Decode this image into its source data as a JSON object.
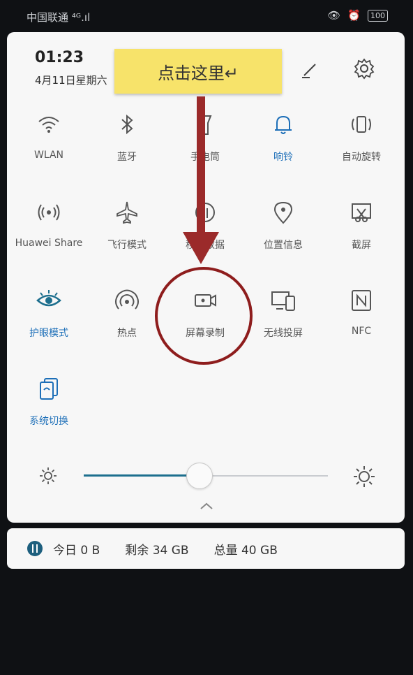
{
  "statusbar": {
    "carrier": "中国联通",
    "signal": "⁴ᴳ.ıl",
    "battery": "100"
  },
  "header": {
    "time": "01:23",
    "date": "4月11日星期六"
  },
  "annotation": {
    "callout_text": "点击这里↵"
  },
  "tiles": [
    {
      "label": "WLAN",
      "icon": "wifi-icon",
      "active": false
    },
    {
      "label": "蓝牙",
      "icon": "bluetooth-icon",
      "active": false
    },
    {
      "label": "手电筒",
      "icon": "flashlight-icon",
      "active": false
    },
    {
      "label": "响铃",
      "icon": "bell-icon",
      "active": true
    },
    {
      "label": "自动旋转",
      "icon": "rotate-icon",
      "active": false
    },
    {
      "label": "Huawei Share",
      "icon": "share-icon",
      "active": false
    },
    {
      "label": "飞行模式",
      "icon": "airplane-icon",
      "active": false
    },
    {
      "label": "移动数据",
      "icon": "mobile-data-icon",
      "active": false
    },
    {
      "label": "位置信息",
      "icon": "location-icon",
      "active": false
    },
    {
      "label": "截屏",
      "icon": "screenshot-icon",
      "active": false
    },
    {
      "label": "护眼模式",
      "icon": "eye-icon",
      "active": true
    },
    {
      "label": "热点",
      "icon": "hotspot-icon",
      "active": false
    },
    {
      "label": "屏幕录制",
      "icon": "screen-record-icon",
      "active": false
    },
    {
      "label": "无线投屏",
      "icon": "cast-icon",
      "active": false
    },
    {
      "label": "NFC",
      "icon": "nfc-icon",
      "active": false
    },
    {
      "label": "系统切换",
      "icon": "system-switch-icon",
      "active": true
    }
  ],
  "brightness": {
    "level": 0.47
  },
  "storage": {
    "today": "今日 0 B",
    "remaining": "剩余 34 GB",
    "total": "总量 40 GB"
  },
  "colors": {
    "accent": "#1d6fb8",
    "callout": "#f7e36a",
    "annotation": "#8e1d1d"
  }
}
